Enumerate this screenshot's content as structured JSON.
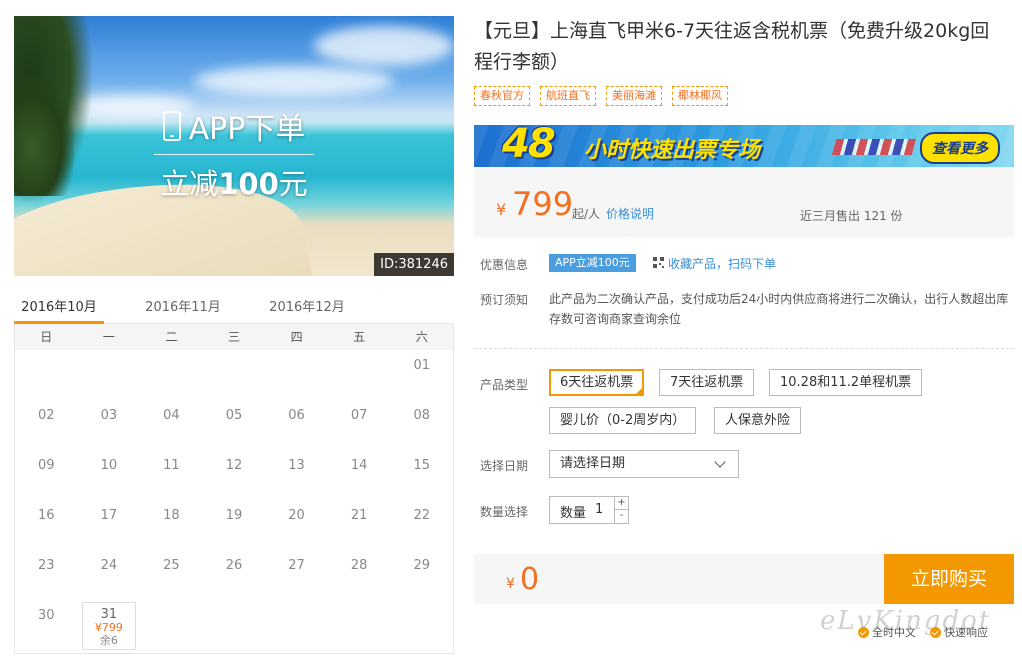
{
  "hero": {
    "promo_line1": "APP下单",
    "promo_line2_prefix": "立减",
    "promo_line2_amount": "100",
    "promo_line2_suffix": "元",
    "id_tag": "ID:381246"
  },
  "calendar": {
    "tabs": [
      "2016年10月",
      "2016年11月",
      "2016年12月"
    ],
    "active_tab": 0,
    "weekdays": [
      "日",
      "一",
      "二",
      "三",
      "四",
      "五",
      "六"
    ],
    "days": [
      "",
      "",
      "",
      "",
      "",
      "",
      "01",
      "02",
      "03",
      "04",
      "05",
      "06",
      "07",
      "08",
      "09",
      "10",
      "11",
      "12",
      "13",
      "14",
      "15",
      "16",
      "17",
      "18",
      "19",
      "20",
      "21",
      "22",
      "23",
      "24",
      "25",
      "26",
      "27",
      "28",
      "29",
      "30",
      "31"
    ],
    "available": {
      "day": "31",
      "price": "¥799",
      "stock": "余6"
    }
  },
  "product": {
    "title": "【元旦】上海直飞甲米6-7天往返含税机票（免费升级20kg回程行李额）",
    "tags": [
      "春秋官方",
      "航班直飞",
      "美丽海滩",
      "椰林椰风"
    ],
    "banner": {
      "number": "48",
      "text": "小时快速出票专场",
      "more": "查看更多"
    },
    "price": {
      "currency": "¥",
      "amount": "799",
      "unit": "起/人",
      "explain": "价格说明",
      "sold": "近三月售出 121 份"
    },
    "offer": {
      "label": "优惠信息",
      "badge": "APP立减100元",
      "favorite": "收藏产品",
      "separator": "，",
      "scan": "扫码下单"
    },
    "notice": {
      "label": "预订须知",
      "text": "此产品为二次确认产品，支付成功后24小时内供应商将进行二次确认，出行人数超出库存数可咨询商家查询余位"
    },
    "types": {
      "label": "产品类型",
      "options": [
        "6天往返机票",
        "7天往返机票",
        "10.28和11.2单程机票",
        "婴儿价（0-2周岁内）",
        "人保意外险"
      ],
      "selected": 0
    },
    "date": {
      "label": "选择日期",
      "value": "请选择日期"
    },
    "quantity": {
      "label": "数量选择",
      "field_label": "数量",
      "value": "1",
      "plus": "+",
      "minus": "-"
    },
    "buy": {
      "currency": "¥",
      "total": "0",
      "button": "立即购买"
    },
    "guarantees": [
      "全时中文",
      "快速响应"
    ]
  },
  "watermark": "eLvKingdot",
  "colors": {
    "accent": "#f39800",
    "price": "#f37021",
    "link": "#3a8fd8",
    "badge": "#4a9ee0"
  }
}
